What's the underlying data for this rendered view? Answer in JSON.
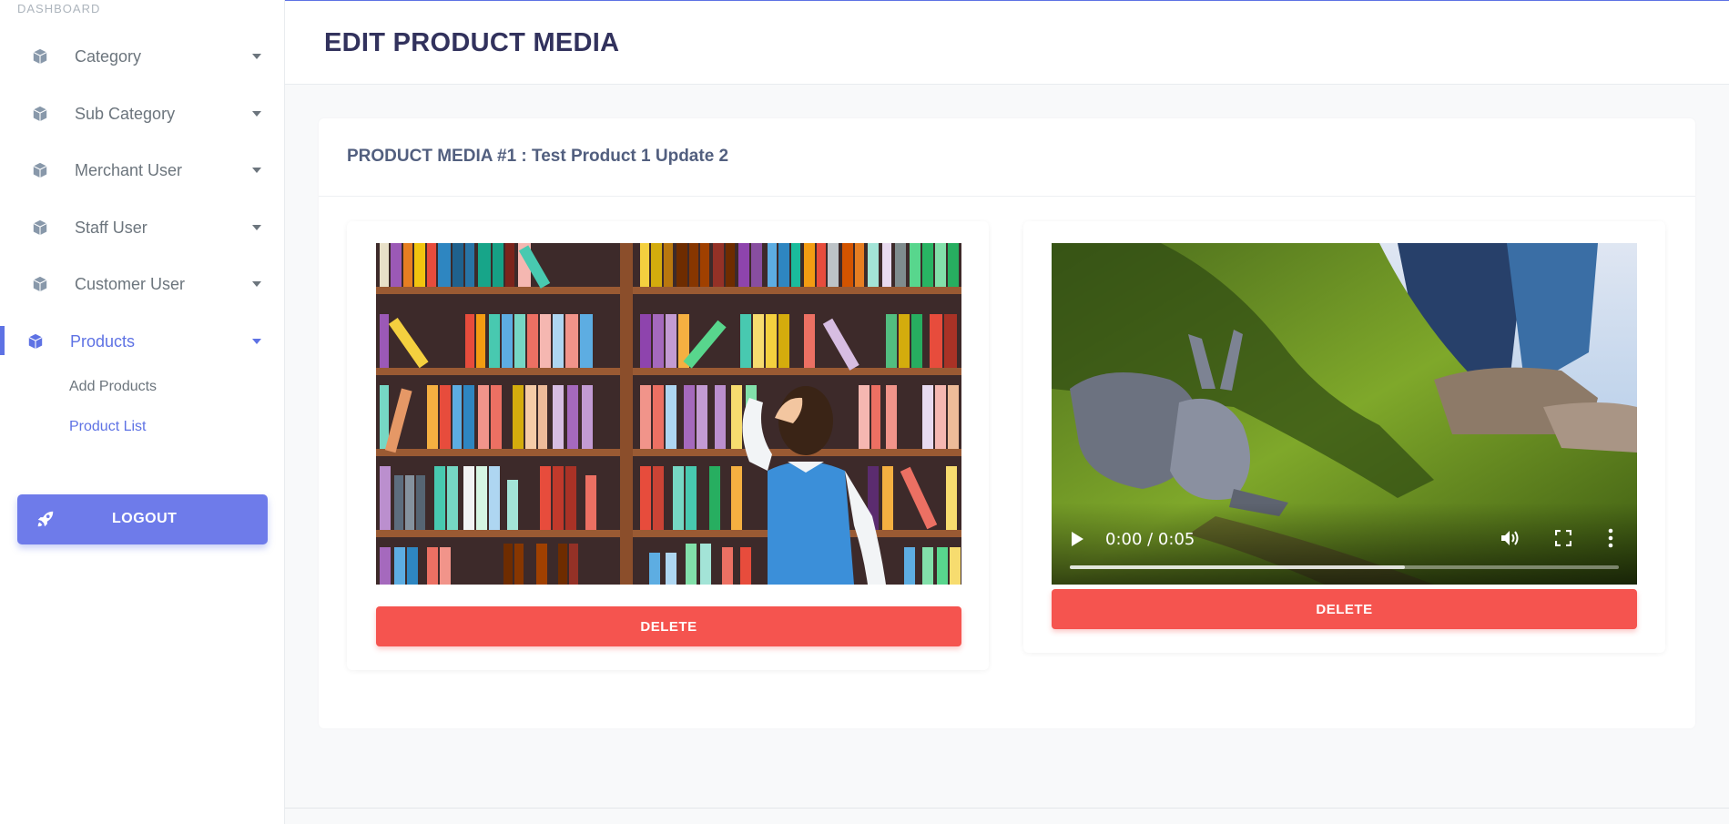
{
  "sidebar": {
    "section_label": "DASHBOARD",
    "items": [
      {
        "label": "Category",
        "icon": "cube-icon"
      },
      {
        "label": "Sub Category",
        "icon": "cube-icon"
      },
      {
        "label": "Merchant User",
        "icon": "cube-icon"
      },
      {
        "label": "Staff User",
        "icon": "cube-icon"
      },
      {
        "label": "Customer User",
        "icon": "cube-icon"
      },
      {
        "label": "Products",
        "icon": "cube-icon",
        "active": true
      }
    ],
    "sub_items": [
      {
        "label": "Add Products"
      },
      {
        "label": "Product List",
        "active": true
      }
    ],
    "logout_label": "LOGOUT"
  },
  "header": {
    "title": "EDIT PRODUCT MEDIA"
  },
  "card": {
    "title": "PRODUCT MEDIA #1 : Test Product 1 Update 2"
  },
  "media": [
    {
      "type": "image",
      "delete_label": "DELETE"
    },
    {
      "type": "video",
      "time": "0:00 / 0:05",
      "progress_buffered": 0.61,
      "delete_label": "DELETE"
    }
  ],
  "colors": {
    "accent": "#5e72e4",
    "danger": "#f5544f",
    "title": "#32325d"
  }
}
